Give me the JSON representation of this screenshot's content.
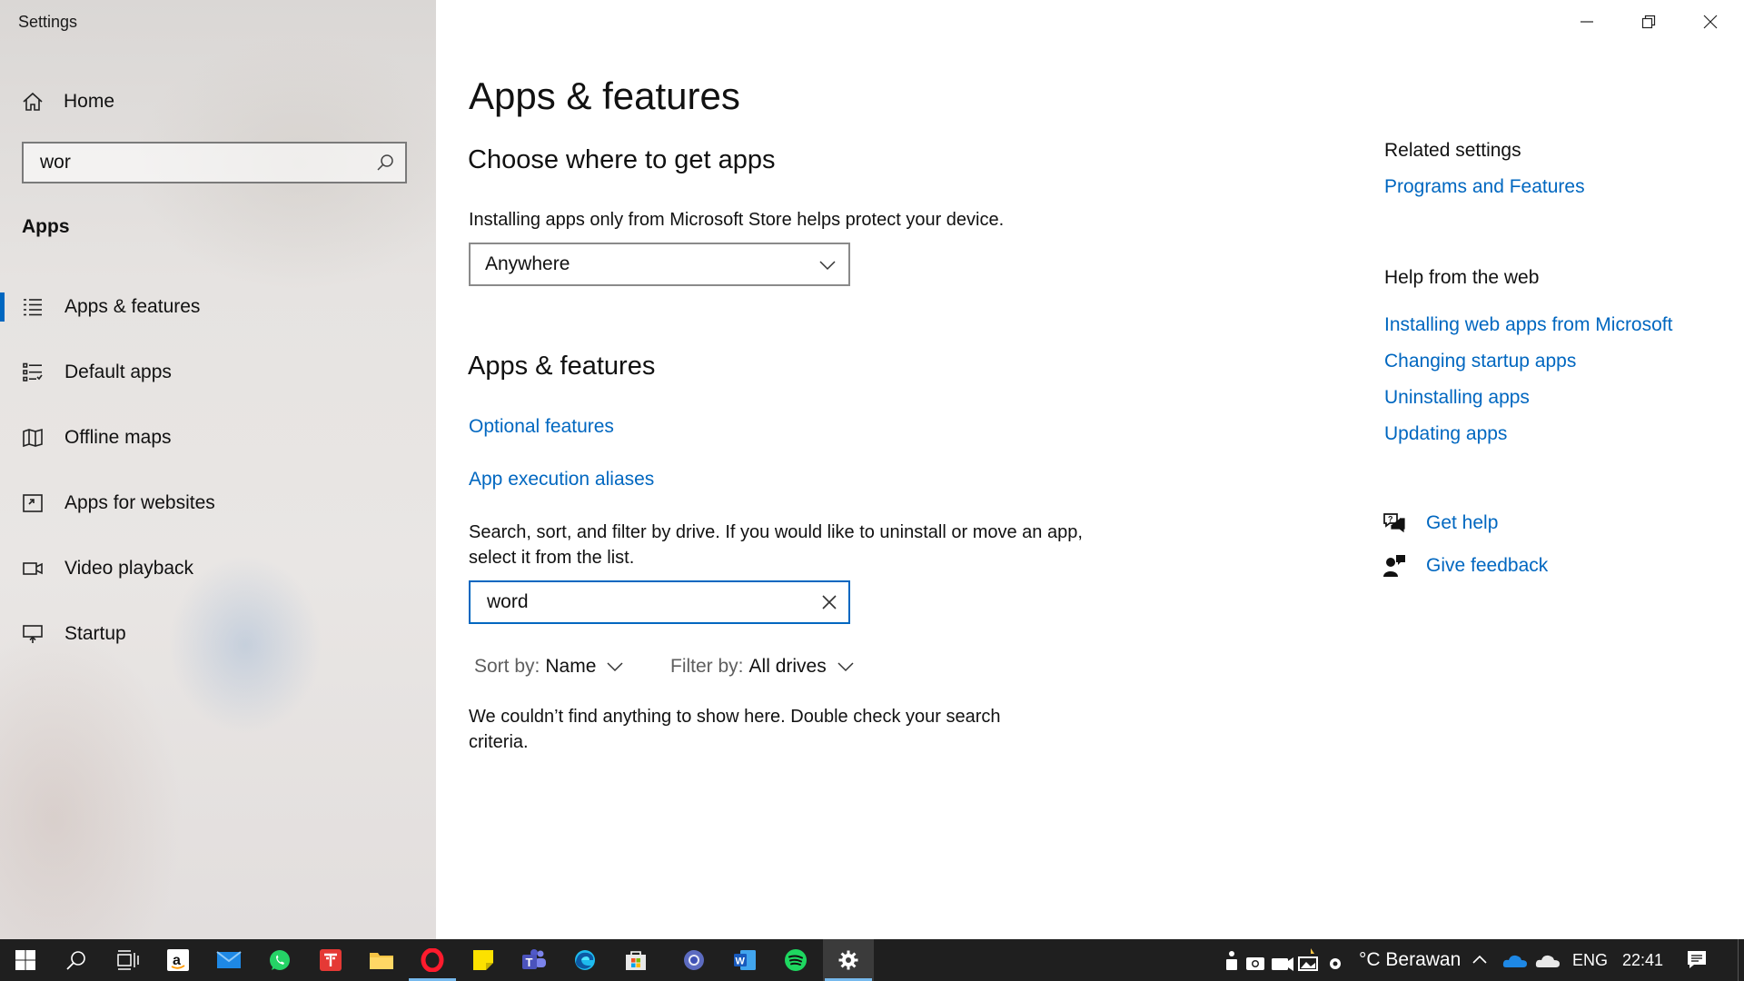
{
  "window": {
    "title": "Settings",
    "controls": [
      "minimize",
      "restore",
      "close"
    ]
  },
  "sidebar": {
    "home_label": "Home",
    "search_value": "wor",
    "section_label": "Apps",
    "items": [
      {
        "label": "Apps & features",
        "icon": "list-icon",
        "selected": true
      },
      {
        "label": "Default apps",
        "icon": "default-apps-icon",
        "selected": false
      },
      {
        "label": "Offline maps",
        "icon": "map-icon",
        "selected": false
      },
      {
        "label": "Apps for websites",
        "icon": "open-in-app-icon",
        "selected": false
      },
      {
        "label": "Video playback",
        "icon": "video-icon",
        "selected": false
      },
      {
        "label": "Startup",
        "icon": "startup-monitor-icon",
        "selected": false
      }
    ]
  },
  "main": {
    "title": "Apps & features",
    "choose_heading": "Choose where to get apps",
    "choose_desc": "Installing apps only from Microsoft Store helps protect your device.",
    "source_dropdown_value": "Anywhere",
    "apps_heading": "Apps & features",
    "optional_features_link": "Optional features",
    "aliases_link": "App execution aliases",
    "search_desc": "Search, sort, and filter by drive. If you would like to uninstall or move an app, select it from the list.",
    "app_search_value": "word",
    "sort_label": "Sort by:",
    "sort_value": "Name",
    "filter_label": "Filter by:",
    "filter_value": "All drives",
    "empty_message": "We couldn’t find anything to show here. Double check your search criteria."
  },
  "related": {
    "heading": "Related settings",
    "programs_link": "Programs and Features",
    "web_heading": "Help from the web",
    "web_links": [
      "Installing web apps from Microsoft",
      "Changing startup apps",
      "Uninstalling apps",
      "Updating apps"
    ],
    "get_help": "Get help",
    "give_feedback": "Give feedback"
  },
  "taskbar": {
    "apps": [
      "start",
      "search",
      "task-view",
      "amazon",
      "mail",
      "whatsapp",
      "tableplus",
      "file-explorer",
      "opera",
      "sticky-notes",
      "teams",
      "edge",
      "microsoft-store",
      "chrome",
      "word",
      "spotify",
      "settings"
    ],
    "active_app": "settings",
    "weather_text": "°C Berawan",
    "language": "ENG",
    "time": "22:41"
  },
  "colors": {
    "accent": "#0067c0",
    "taskbar": "#1f1f1f",
    "link": "#0067c0"
  }
}
